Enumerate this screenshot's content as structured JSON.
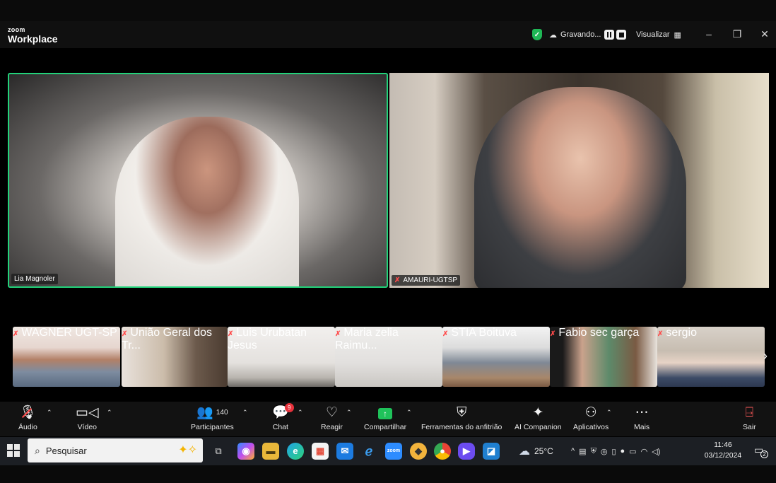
{
  "app": {
    "logo_small": "zoom",
    "logo_big": "Workplace"
  },
  "titlebar": {
    "recording_label": "Gravando...",
    "view_label": "Visualizar",
    "minimize_glyph": "–",
    "restore_glyph": "❐",
    "close_glyph": "✕"
  },
  "main_videos": [
    {
      "name": "Lia Magnoler",
      "muted": false,
      "active_speaker": true
    },
    {
      "name": "AMAURI-UGTSP",
      "muted": true,
      "active_speaker": false
    }
  ],
  "gallery": [
    {
      "name": "WAGNER UGT-SP",
      "muted": true
    },
    {
      "name": "União Geral dos Tr...",
      "muted": true
    },
    {
      "name": "Luis Urubatan Jesus",
      "muted": true
    },
    {
      "name": "Maria zelia Raimu...",
      "muted": true
    },
    {
      "name": "STIA Boituva",
      "muted": true
    },
    {
      "name": "Fabio sec garça",
      "muted": true
    },
    {
      "name": "sergio",
      "muted": true
    }
  ],
  "toolbar": {
    "audio": "Áudio",
    "video": "Vídeo",
    "participants": "Participantes",
    "participants_count": "140",
    "chat": "Chat",
    "chat_badge": "9",
    "react": "Reagir",
    "share": "Compartilhar",
    "host_tools": "Ferramentas do anfitrião",
    "ai": "AI Companion",
    "apps": "Aplicativos",
    "more": "Mais",
    "leave": "Sair"
  },
  "taskbar": {
    "search_placeholder": "Pesquisar",
    "weather": "25°C",
    "time": "11:46",
    "date": "03/12/2024",
    "notification_count": "2"
  },
  "colors": {
    "active_speaker_border": "#22d27a",
    "share_green": "#1fc25a",
    "badge_red": "#e8323c",
    "muted_red": "#ff4b4b"
  }
}
